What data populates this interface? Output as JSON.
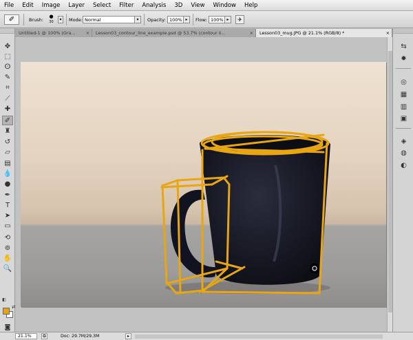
{
  "menu": [
    "File",
    "Edit",
    "Image",
    "Layer",
    "Select",
    "Filter",
    "Analysis",
    "3D",
    "View",
    "Window",
    "Help"
  ],
  "options": {
    "tool_preset_icon": "brush-icon",
    "brush_label": "Brush:",
    "brush_size": "30",
    "mode_label": "Mode:",
    "mode_value": "Normal",
    "opacity_label": "Opacity:",
    "opacity_value": "100%",
    "flow_label": "Flow:",
    "flow_value": "100%"
  },
  "tabs": [
    {
      "label": "Untitled-1 @ 100% (Gra..."
    },
    {
      "label": "Lesson03_contour_line_example.psd @ 53.7% (contour li..."
    },
    {
      "label": "Lesson03_mug.JPG @ 21.1% (RGB/8) *"
    }
  ],
  "tools": [
    {
      "name": "move-icon",
      "glyph": "✥"
    },
    {
      "name": "marquee-icon",
      "glyph": "⬚"
    },
    {
      "name": "lasso-icon",
      "glyph": "ⵙ"
    },
    {
      "name": "quick-select-icon",
      "glyph": "✎"
    },
    {
      "name": "crop-icon",
      "glyph": "⌗"
    },
    {
      "name": "eyedropper-icon",
      "glyph": "⟋"
    },
    {
      "name": "healing-brush-icon",
      "glyph": "✚"
    },
    {
      "name": "brush-icon",
      "glyph": "✐"
    },
    {
      "name": "clone-stamp-icon",
      "glyph": "♜"
    },
    {
      "name": "history-brush-icon",
      "glyph": "↺"
    },
    {
      "name": "eraser-icon",
      "glyph": "▱"
    },
    {
      "name": "gradient-icon",
      "glyph": "▤"
    },
    {
      "name": "blur-icon",
      "glyph": "💧"
    },
    {
      "name": "dodge-icon",
      "glyph": "●"
    },
    {
      "name": "pen-icon",
      "glyph": "✒"
    },
    {
      "name": "type-icon",
      "glyph": "T"
    },
    {
      "name": "path-select-icon",
      "glyph": "➤"
    },
    {
      "name": "shape-icon",
      "glyph": "▭"
    },
    {
      "name": "3d-rotate-icon",
      "glyph": "⟲"
    },
    {
      "name": "3d-orbit-icon",
      "glyph": "⊚"
    },
    {
      "name": "hand-icon",
      "glyph": "✋"
    },
    {
      "name": "zoom-icon",
      "glyph": "🔍"
    }
  ],
  "colors": {
    "foreground": "#e5a319",
    "background": "#ffffff",
    "sketch": "#e8a612"
  },
  "right_panel": [
    {
      "name": "arrows-icon",
      "glyph": "⇆"
    },
    {
      "name": "navigator-icon",
      "glyph": "✹"
    },
    {
      "name": "adjustments-icon",
      "glyph": "◎"
    },
    {
      "name": "styles-icon",
      "glyph": "▦"
    },
    {
      "name": "history-icon",
      "glyph": "▥"
    },
    {
      "name": "actions-icon",
      "glyph": "▣"
    },
    {
      "name": "layers-icon",
      "glyph": "◈"
    },
    {
      "name": "channels-icon",
      "glyph": "◍"
    },
    {
      "name": "paths-icon",
      "glyph": "◐"
    }
  ],
  "status": {
    "zoom": "21.1%",
    "doc_info": "Doc: 29.7M/29.3M"
  }
}
